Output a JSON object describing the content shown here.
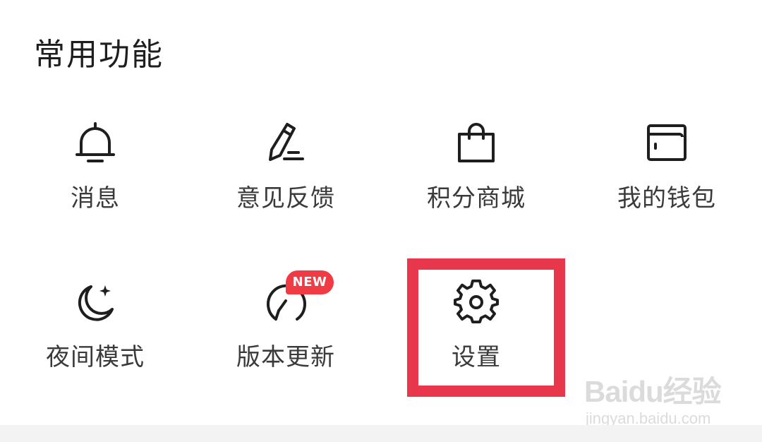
{
  "section": {
    "title": "常用功能"
  },
  "items": [
    {
      "label": "消息",
      "icon": "bell-icon"
    },
    {
      "label": "意见反馈",
      "icon": "pencil-icon"
    },
    {
      "label": "积分商城",
      "icon": "shopping-bag-icon"
    },
    {
      "label": "我的钱包",
      "icon": "wallet-icon"
    },
    {
      "label": "夜间模式",
      "icon": "moon-icon"
    },
    {
      "label": "版本更新",
      "icon": "update-icon",
      "badge": "NEW"
    },
    {
      "label": "设置",
      "icon": "gear-icon"
    }
  ],
  "colors": {
    "highlight": "#e8364a",
    "badge": "#f03b44",
    "text": "#3a3a3a",
    "icon": "#1e1e1e"
  },
  "watermark": {
    "brand": "Baidu经验",
    "url": "jingyan.baidu.com"
  }
}
